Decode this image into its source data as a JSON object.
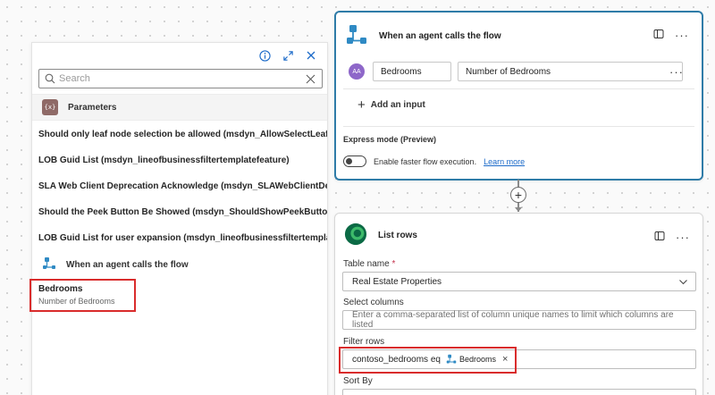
{
  "panel": {
    "search_placeholder": "Search",
    "section_icon_text": "{x}",
    "section_title": "Parameters",
    "parameters": [
      "Should only leaf node selection be allowed (msdyn_AllowSelectLeafOnly)",
      "LOB Guid List (msdyn_lineofbusinessfiltertemplatefeature)",
      "SLA Web Client Deprecation Acknowledge (msdyn_SLAWebClientDeprecationAckn...",
      "Should the Peek Button Be Showed (msdyn_ShouldShowPeekButton)",
      "LOB Guid List for user expansion (msdyn_lineofbusinessfiltertemplatefeatureusere..."
    ],
    "trigger_group_title": "When an agent calls the flow",
    "trigger_output": {
      "name": "Bedrooms",
      "description": "Number of Bedrooms"
    }
  },
  "trigger_card": {
    "title": "When an agent calls the flow",
    "input": {
      "avatar_text": "AA",
      "name": "Bedrooms",
      "description": "Number of Bedrooms"
    },
    "add_input_label": "Add an input",
    "express_mode_label": "Express mode (Preview)",
    "toggle_label": "Enable faster flow execution.",
    "learn_more": "Learn more"
  },
  "list_card": {
    "title": "List rows",
    "table_name_label": "Table name",
    "required_mark": "*",
    "table_name_value": "Real Estate Properties",
    "select_columns_label": "Select columns",
    "select_columns_placeholder": "Enter a comma-separated list of column unique names to limit which columns are listed",
    "filter_rows_label": "Filter rows",
    "filter_text": "contoso_bedrooms eq",
    "filter_token": "Bedrooms",
    "sort_by_label": "Sort By"
  },
  "colors": {
    "accent": "#2f7ca8",
    "highlight": "#d92c2c",
    "link": "#1b6ac9"
  }
}
